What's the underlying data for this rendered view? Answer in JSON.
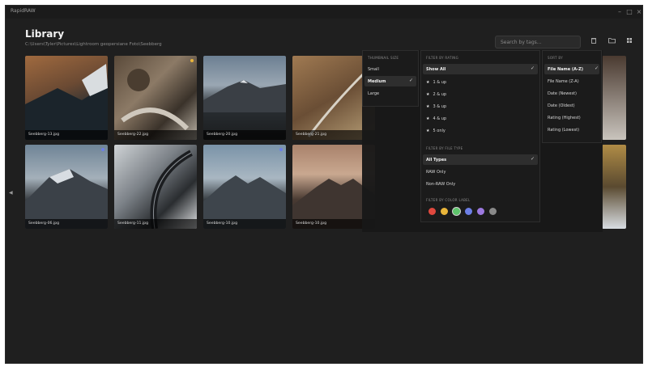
{
  "window": {
    "title": "RapidRAW",
    "minimize": "–",
    "maximize": "□",
    "close": "×"
  },
  "header": {
    "title": "Library",
    "path": "C:\\Users\\Tyler\\Pictures\\Lightroom geopersiane Foto\\Seebberg"
  },
  "search": {
    "placeholder": "Search by tags..."
  },
  "toolbar": {
    "icons": [
      "trash-icon",
      "folder-icon",
      "grid-icon"
    ]
  },
  "thumbnails": [
    {
      "label": "Seebberg-13.jpg"
    },
    {
      "label": "Seebberg-22.jpg"
    },
    {
      "label": "Seebberg-20.jpg"
    },
    {
      "label": "Seebberg-21.jpg"
    },
    {
      "label": "Seebberg-06.jpg"
    },
    {
      "label": "Seebberg-11.jpg"
    },
    {
      "label": "Seebberg-10.jpg"
    },
    {
      "label": "Seebberg-10.jpg"
    }
  ],
  "thumbnail_size": {
    "header": "THUMBNAIL SIZE",
    "options": [
      "Small",
      "Medium",
      "Large"
    ],
    "selected": "Medium"
  },
  "filter_rating": {
    "header": "FILTER BY RATING",
    "options": [
      "Show All",
      "1 & up",
      "2 & up",
      "3 & up",
      "4 & up",
      "5 only"
    ],
    "selected": "Show All"
  },
  "filter_file_type": {
    "header": "FILTER BY FILE TYPE",
    "options": [
      "All Types",
      "RAW Only",
      "Non-RAW Only"
    ],
    "selected": "All Types"
  },
  "filter_color": {
    "header": "FILTER BY COLOR LABEL",
    "colors": [
      "#e0483e",
      "#e9b53a",
      "#5ec46b",
      "#6d7fe6",
      "#9c79e0",
      "#8a8a8a"
    ]
  },
  "sort_by": {
    "header": "SORT BY",
    "options": [
      "File Name (A-Z)",
      "File Name (Z-A)",
      "Date (Newest)",
      "Date (Oldest)",
      "Rating (Highest)",
      "Rating (Lowest)"
    ],
    "selected": "File Name (A-Z)"
  },
  "check_glyph": "✓",
  "star_glyph": "★",
  "left_arrow_glyph": "◀"
}
